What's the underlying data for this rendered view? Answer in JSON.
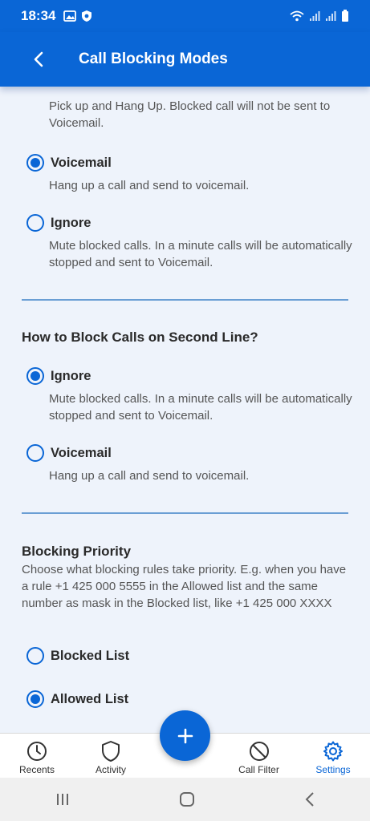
{
  "status_bar": {
    "time": "18:34"
  },
  "app_bar": {
    "title": "Call Blocking Modes"
  },
  "section1": {
    "cut_text": "Pick up and Hang Up. Blocked call will not be sent to Voicemail.",
    "options": [
      {
        "label": "Voicemail",
        "desc": "Hang up a call and send to voicemail.",
        "selected": true
      },
      {
        "label": "Ignore",
        "desc": "Mute blocked calls. In a minute calls will be automatically stopped and sent to Voicemail.",
        "selected": false
      }
    ]
  },
  "section2": {
    "heading": "How to Block Calls on Second Line?",
    "options": [
      {
        "label": "Ignore",
        "desc": "Mute blocked calls. In a minute calls will be automatically stopped and sent to Voicemail.",
        "selected": true
      },
      {
        "label": "Voicemail",
        "desc": "Hang up a call and send to voicemail.",
        "selected": false
      }
    ]
  },
  "section3": {
    "heading": "Blocking Priority",
    "desc": "Choose what blocking rules take priority. E.g. when you have a rule +1 425 000 5555 in the Allowed list and the same number as mask in the Blocked list, like +1 425 000 XXXX",
    "options": [
      {
        "label": "Blocked List",
        "selected": false
      },
      {
        "label": "Allowed List",
        "selected": true
      }
    ]
  },
  "bottom_nav": {
    "items": [
      {
        "label": "Recents",
        "icon": "clock-icon"
      },
      {
        "label": "Activity",
        "icon": "shield-icon"
      },
      {
        "label": "Call Filter",
        "icon": "block-icon"
      },
      {
        "label": "Settings",
        "icon": "gear-icon",
        "active": true
      }
    ]
  },
  "colors": {
    "primary": "#0a66d6",
    "background": "#eef3fb"
  }
}
